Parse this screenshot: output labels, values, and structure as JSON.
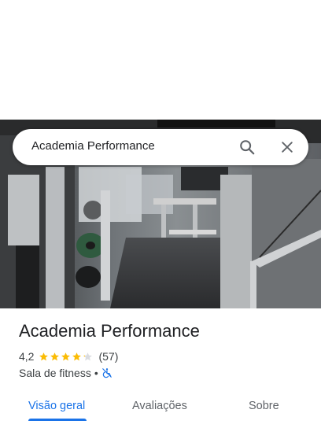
{
  "search": {
    "value": "Academia Performance",
    "search_icon": "search-icon",
    "clear_icon": "close-icon"
  },
  "place": {
    "name": "Academia Performance",
    "rating": "4,2",
    "stars": 4.2,
    "reviews": "(57)",
    "category": "Sala de fitness",
    "separator": "•",
    "accessibility_icon": "not-accessible-icon"
  },
  "tabs": [
    {
      "label": "Visão geral",
      "active": true
    },
    {
      "label": "Avaliações",
      "active": false
    },
    {
      "label": "Sobre",
      "active": false
    }
  ],
  "colors": {
    "accent": "#1a73e8",
    "star": "#fbbc04",
    "star_empty": "#dadce0",
    "text": "#202124"
  }
}
